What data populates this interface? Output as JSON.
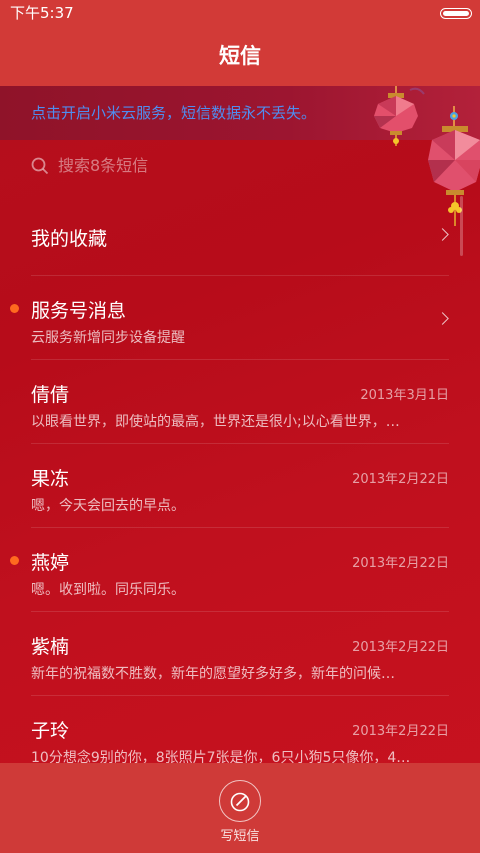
{
  "status_bar": {
    "time": "下午5:37"
  },
  "header": {
    "title": "短信"
  },
  "banner": {
    "text": "点击开启小米云服务，短信数据永不丢失。"
  },
  "search": {
    "placeholder": "搜索8条短信"
  },
  "favorites": {
    "label": "我的收藏"
  },
  "conversations": [
    {
      "name": "服务号消息",
      "preview": "云服务新增同步设备提醒",
      "date": "",
      "unread": true,
      "chevron": true
    },
    {
      "name": "倩倩",
      "preview": "以眼看世界，即使站的最高，世界还是很小;以心看世界，…",
      "date": "2013年3月1日",
      "unread": false,
      "chevron": false
    },
    {
      "name": "果冻",
      "preview": "嗯，今天会回去的早点。",
      "date": "2013年2月22日",
      "unread": false,
      "chevron": false
    },
    {
      "name": "燕婷",
      "preview": "嗯。收到啦。同乐同乐。",
      "date": "2013年2月22日",
      "unread": true,
      "chevron": false
    },
    {
      "name": "紫楠",
      "preview": "新年的祝福数不胜数，新年的愿望好多好多，新年的问候…",
      "date": "2013年2月22日",
      "unread": false,
      "chevron": false
    },
    {
      "name": "子玲",
      "preview": "10分想念9别的你，8张照片7张是你，6只小狗5只像你，4…",
      "date": "2013年2月22日",
      "unread": false,
      "chevron": false
    }
  ],
  "bottom": {
    "compose_label": "写短信"
  },
  "colors": {
    "bar": "#d23a37",
    "background": "#b70c1a",
    "unread_dot": "#ff6a1f",
    "banner_text": "#4f8df0"
  },
  "icons": {
    "search": "search-icon",
    "compose": "pen-icon",
    "chevron": "chevron-right-icon"
  }
}
